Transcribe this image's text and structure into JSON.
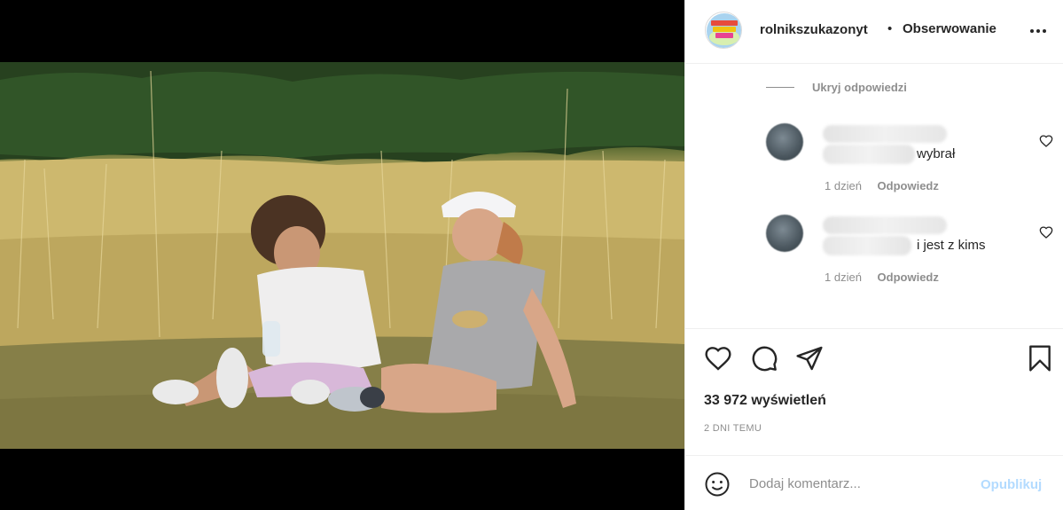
{
  "post": {
    "username": "rolnikszukazonyt",
    "separator": "•",
    "follow_label": "Obserwowanie",
    "logo_text": [
      "ROLNIK",
      "SZUKA",
      "ŻONY"
    ],
    "more_icon": "more-horizontal-icon"
  },
  "video": {
    "mute_icon": "volume-muted-icon"
  },
  "comments": {
    "hide_replies_label": "Ukryj odpowiedzi",
    "replies": [
      {
        "visible_text": "wybrał",
        "time": "1 dzień",
        "reply_label": "Odpowiedz"
      },
      {
        "visible_text": "i jest z kims",
        "time": "1 dzień",
        "reply_label": "Odpowiedz"
      }
    ]
  },
  "actions": {
    "views": "33 972 wyświetleń",
    "time_ago": "2 DNI TEMU",
    "icons": [
      "heart-icon",
      "comment-icon",
      "share-icon",
      "bookmark-icon"
    ]
  },
  "add_comment": {
    "placeholder": "Dodaj komentarz...",
    "publish_label": "Opublikuj",
    "publish_color": "#b3dbff"
  }
}
